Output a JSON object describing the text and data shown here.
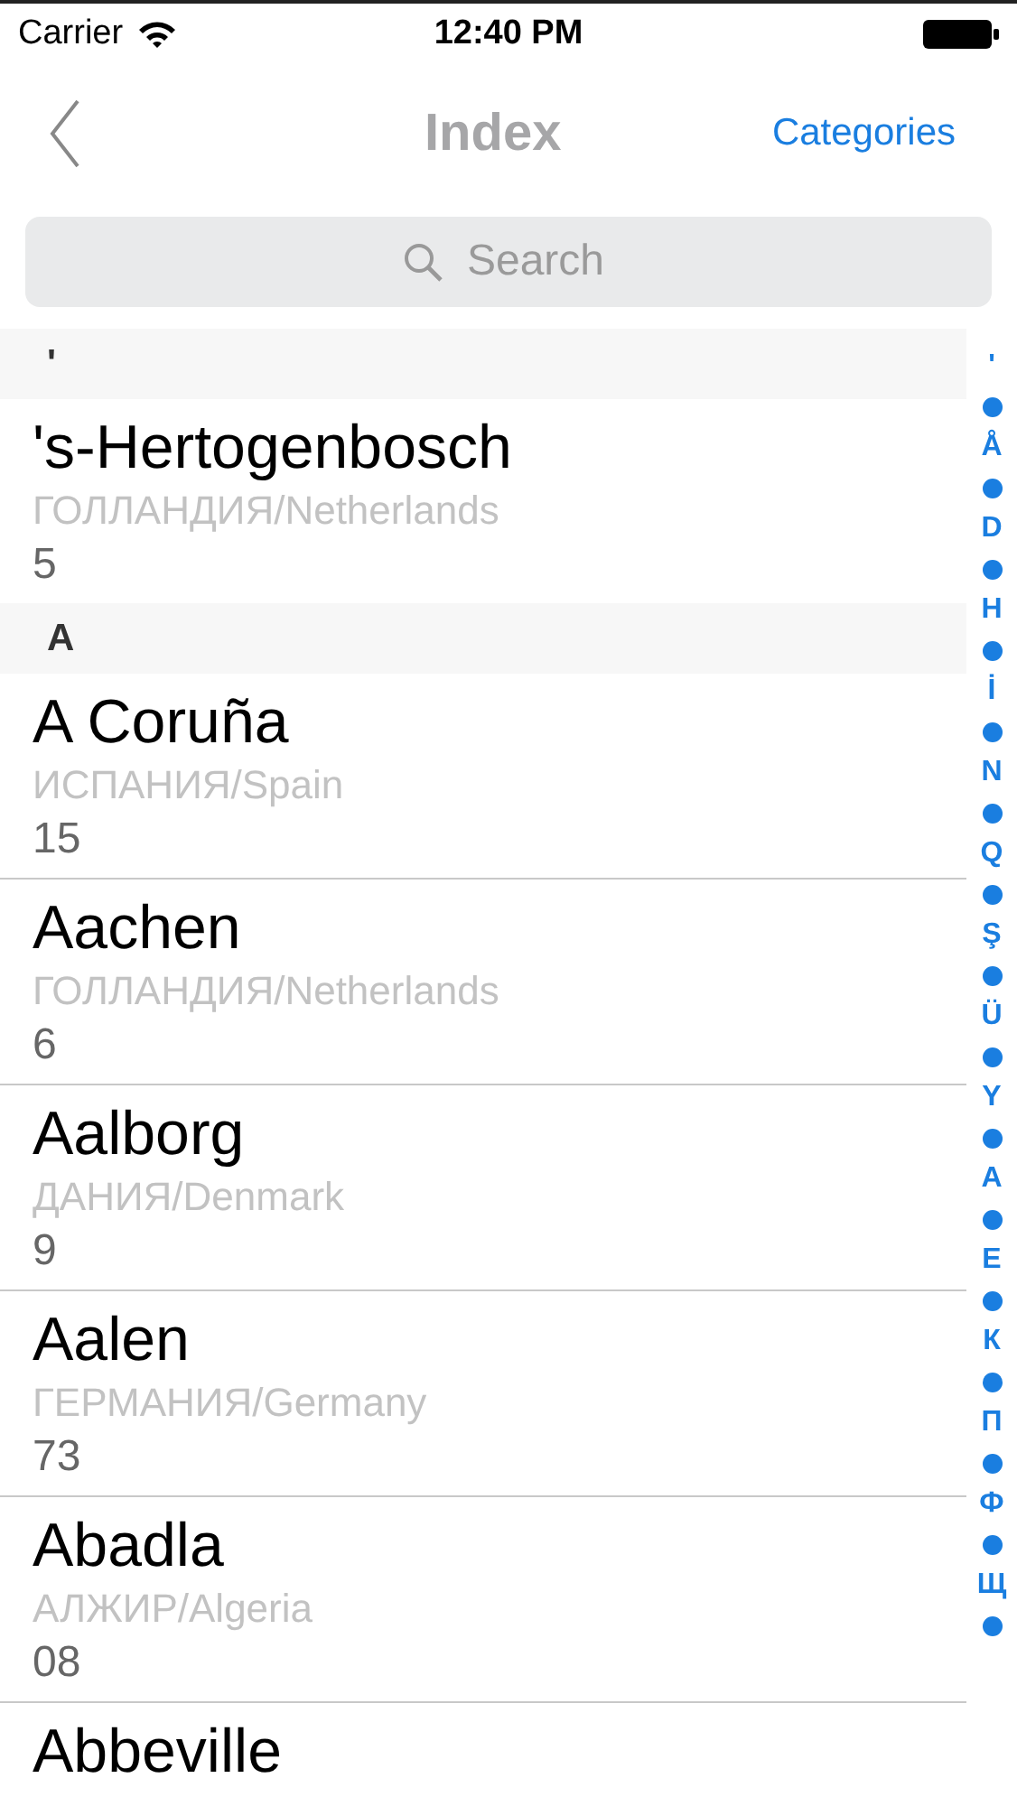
{
  "status_bar": {
    "carrier": "Carrier",
    "time": "12:40 PM"
  },
  "nav": {
    "title": "Index",
    "action": "Categories"
  },
  "search": {
    "placeholder": "Search"
  },
  "sections": [
    {
      "header": "'",
      "rows": [
        {
          "name": "'s-Hertogenbosch",
          "country": "ГОЛЛАНДИЯ/Netherlands",
          "count": "5"
        }
      ]
    },
    {
      "header": "A",
      "rows": [
        {
          "name": "A Coruña",
          "country": "ИСПАНИЯ/Spain",
          "count": "15"
        },
        {
          "name": "Aachen",
          "country": "ГОЛЛАНДИЯ/Netherlands",
          "count": "6"
        },
        {
          "name": "Aalborg",
          "country": "ДАНИЯ/Denmark",
          "count": "9"
        },
        {
          "name": "Aalen",
          "country": "ГЕРМАНИЯ/Germany",
          "count": "73"
        },
        {
          "name": "Abadla",
          "country": "АЛЖИР/Algeria",
          "count": "08"
        },
        {
          "name": "Abbeville"
        }
      ]
    }
  ],
  "index": [
    {
      "kind": "letter",
      "text": "'"
    },
    {
      "kind": "dot"
    },
    {
      "kind": "letter",
      "text": "Å"
    },
    {
      "kind": "dot"
    },
    {
      "kind": "letter",
      "text": "D"
    },
    {
      "kind": "dot"
    },
    {
      "kind": "letter",
      "text": "H"
    },
    {
      "kind": "dot"
    },
    {
      "kind": "letter",
      "text": "İ"
    },
    {
      "kind": "dot"
    },
    {
      "kind": "letter",
      "text": "N"
    },
    {
      "kind": "dot"
    },
    {
      "kind": "letter",
      "text": "Q"
    },
    {
      "kind": "dot"
    },
    {
      "kind": "letter",
      "text": "Ş"
    },
    {
      "kind": "dot"
    },
    {
      "kind": "letter",
      "text": "Ü"
    },
    {
      "kind": "dot"
    },
    {
      "kind": "letter",
      "text": "Y"
    },
    {
      "kind": "dot"
    },
    {
      "kind": "letter",
      "text": "А"
    },
    {
      "kind": "dot"
    },
    {
      "kind": "letter",
      "text": "Е"
    },
    {
      "kind": "dot"
    },
    {
      "kind": "letter",
      "text": "К"
    },
    {
      "kind": "dot"
    },
    {
      "kind": "letter",
      "text": "П"
    },
    {
      "kind": "dot"
    },
    {
      "kind": "letter",
      "text": "Ф"
    },
    {
      "kind": "dot"
    },
    {
      "kind": "letter",
      "text": "Щ"
    },
    {
      "kind": "dot"
    }
  ]
}
